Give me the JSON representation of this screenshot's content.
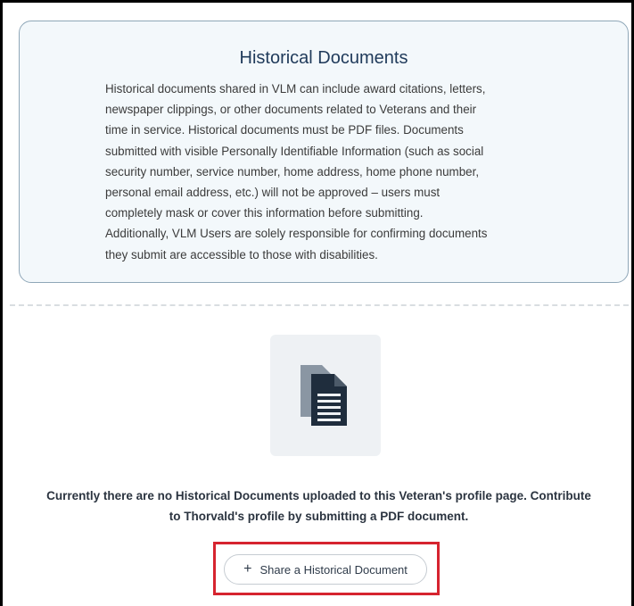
{
  "info_card": {
    "title": "Historical Documents",
    "lines": [
      "Historical documents shared in VLM can include award citations, letters,",
      "newspaper clippings, or other documents related to Veterans and their",
      "time in service. Historical documents must be PDF files. Documents",
      "submitted with visible Personally Identifiable Information (such as social",
      "security number, service number, home address, home phone number,",
      "personal email address, etc.) will not be approved – users must",
      "completely mask or cover this information before submitting.",
      "Additionally, VLM Users are solely responsible for confirming documents",
      "they submit are accessible to those with disabilities."
    ]
  },
  "empty_state": {
    "icon": "document-icon",
    "line1": "Currently there are no Historical Documents uploaded to this Veteran's profile page. Contribute",
    "line2": "to Thorvald's profile by submitting a PDF document."
  },
  "share_button": {
    "icon": "plus-icon",
    "label": "Share a Historical Document"
  },
  "colors": {
    "title": "#1f3a5a",
    "card_bg": "#f3f8fb",
    "card_border": "#8fa7b8",
    "highlight": "#d6242f",
    "doc_icon": "#1f2d3d"
  }
}
